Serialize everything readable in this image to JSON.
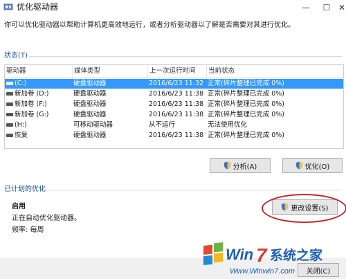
{
  "window": {
    "title": "优化驱动器",
    "minimize": "—",
    "maximize": "☐",
    "close": "✕"
  },
  "intro": "你可以优化驱动器以帮助计算机更高效地运行，或者分析驱动器以了解是否需要对其进行优化。",
  "status": {
    "label": "状态(T)",
    "columns": [
      "驱动器",
      "媒体类型",
      "上一次运行时间",
      "当前状态"
    ],
    "rows": [
      {
        "drive": "(C:)",
        "media": "硬盘驱动器",
        "last_run": "2016/6/23 11:32",
        "state": "正常(碎片整理已完成 0%)",
        "selected": true
      },
      {
        "drive": "新加卷 (D:)",
        "media": "硬盘驱动器",
        "last_run": "2016/6/23 11:38",
        "state": "正常(碎片整理已完成 0%)",
        "selected": false
      },
      {
        "drive": "新加卷 (F:)",
        "media": "硬盘驱动器",
        "last_run": "2016/6/23 11:38",
        "state": "正常(碎片整理已完成 0%)",
        "selected": false
      },
      {
        "drive": "新加卷 (G:)",
        "media": "硬盘驱动器",
        "last_run": "2016/6/23 11:38",
        "state": "正常(碎片整理已完成 0%)",
        "selected": false
      },
      {
        "drive": "(H:)",
        "media": "可移动驱动器",
        "last_run": "从不运行",
        "state": "无法使用优化",
        "selected": false
      },
      {
        "drive": "恢复",
        "media": "硬盘驱动器",
        "last_run": "2016/6/23 11:38",
        "state": "正常(碎片整理已完成 0%)",
        "selected": false
      }
    ]
  },
  "actions": {
    "analyze": "分析(A)",
    "optimize": "优化(O)"
  },
  "scheduled": {
    "label": "已计划的优化",
    "status": "启用",
    "detail": "正在自动优化驱动器。",
    "frequency": "频率: 每周",
    "change_settings": "更改设置(S)"
  },
  "footer": {
    "close_label": "关闭(C)"
  },
  "watermark": {
    "text": "系统之家",
    "url": "Www.Winwin7.com"
  },
  "colors": {
    "selection": "#3399ff",
    "accent_text": "#1a4fa0",
    "highlight_ring": "#c8242a"
  }
}
